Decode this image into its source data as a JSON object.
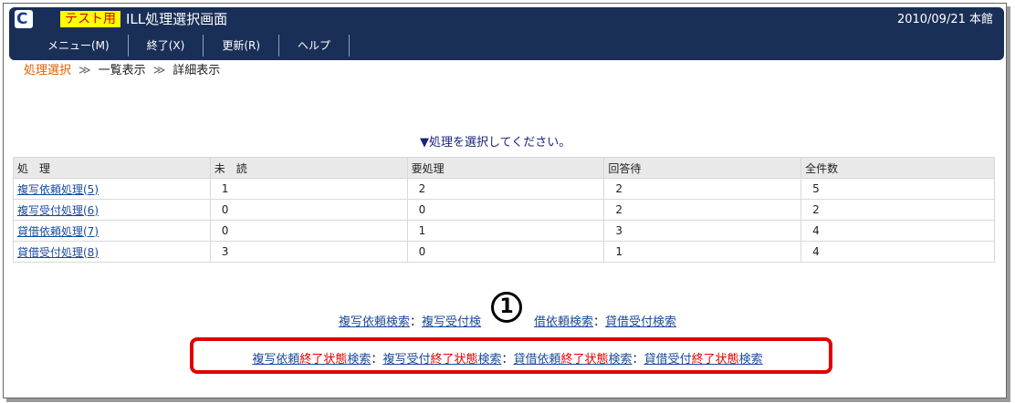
{
  "header": {
    "logo_letter": "C",
    "test_badge": "テスト用",
    "window_title": "ILL処理選択画面",
    "date_library": "2010/09/21 本館"
  },
  "menu": [
    "メニュー(M)",
    "終了(X)",
    "更新(R)",
    "ヘルプ"
  ],
  "breadcrumb": {
    "current": "処理選択",
    "sep": "≫",
    "list": "一覧表示",
    "detail": "詳細表示"
  },
  "instruction": "▼処理を選択してください。",
  "table": {
    "headers": [
      "処　理",
      "未　読",
      "要処理",
      "回答待",
      "全件数"
    ],
    "rows": [
      [
        "複写依頼処理(5)",
        "1",
        "2",
        "2",
        "5"
      ],
      [
        "複写受付処理(6)",
        "0",
        "0",
        "2",
        "2"
      ],
      [
        "貸借依頼処理(7)",
        "0",
        "1",
        "3",
        "4"
      ],
      [
        "貸借受付処理(8)",
        "3",
        "0",
        "1",
        "4"
      ]
    ]
  },
  "search_links": {
    "copy_request": "複写依頼検索",
    "copy_accept_visible": "複写受付検",
    "loan_request_visible": "借依頼検索",
    "loan_accept": "貸借受付検索",
    "colon": "："
  },
  "completed_links": [
    {
      "prefix": "複写依頼",
      "mid": "終了状態",
      "suffix": "検索"
    },
    {
      "prefix": "複写受付",
      "mid": "終了状態",
      "suffix": "検索"
    },
    {
      "prefix": "貸借依頼",
      "mid": "終了状態",
      "suffix": "検索"
    },
    {
      "prefix": "貸借受付",
      "mid": "終了状態",
      "suffix": "検索"
    }
  ],
  "annotation_number": "1"
}
